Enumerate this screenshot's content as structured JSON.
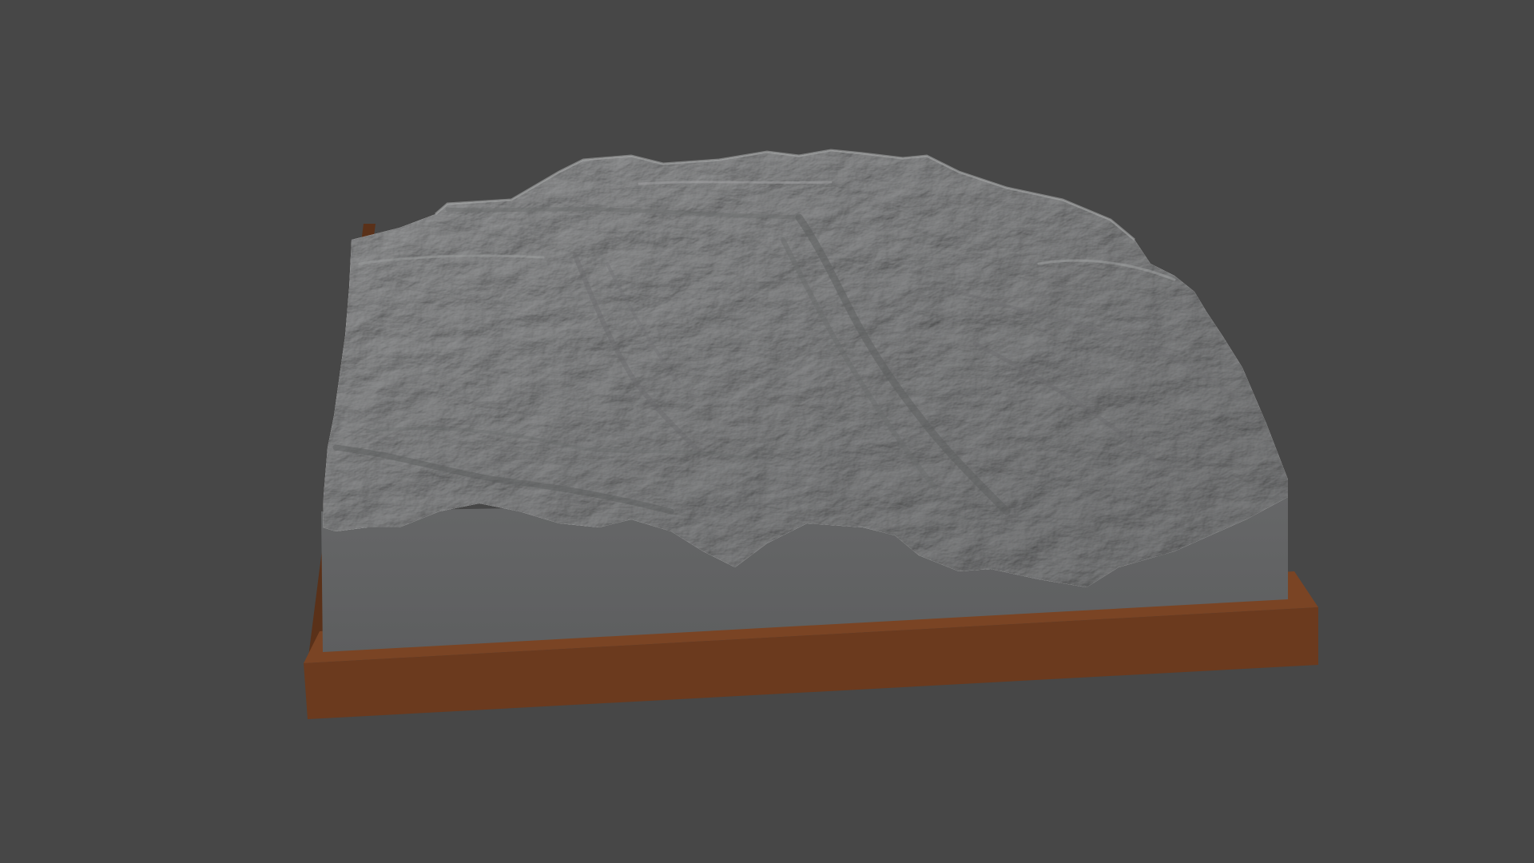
{
  "scene": {
    "background_color": "#474747",
    "terrain_color": "#8c8d8e",
    "terrain_side_color": "#616263",
    "base_top_color": "#7a4424",
    "base_front_color": "#6b3a1e",
    "base_side_color": "#5a3119"
  }
}
